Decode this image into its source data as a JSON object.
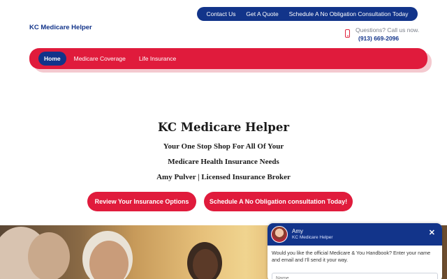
{
  "top_links": [
    "Contact Us",
    "Get A Quote",
    "Schedule A No Obligation Consultation Today"
  ],
  "brand": "KC Medicare Helper",
  "call": {
    "question": "Questions? Call us now.",
    "number": "(913) 669-2096"
  },
  "nav": [
    "Home",
    "Medicare Coverage",
    "Life Insurance"
  ],
  "hero": {
    "title": "KC Medicare Helper",
    "line1": "Your One Stop Shop For All Of Your",
    "line2": "Medicare Health Insurance Needs",
    "line3": "Amy Pulver | Licensed Insurance Broker",
    "cta_review": "Review Your Insurance Options",
    "cta_schedule": "Schedule A No Obligation consultation Today!"
  },
  "chat": {
    "agent_name": "Amy",
    "agent_org": "KC Medicare Helper",
    "close_glyph": "✕",
    "message": "Would you like the official Medicare & You Handbook? Enter your name and email and I'll send it your way.",
    "name_placeholder": "Name"
  },
  "colors": {
    "navy": "#12348a",
    "red": "#e01b3c"
  }
}
